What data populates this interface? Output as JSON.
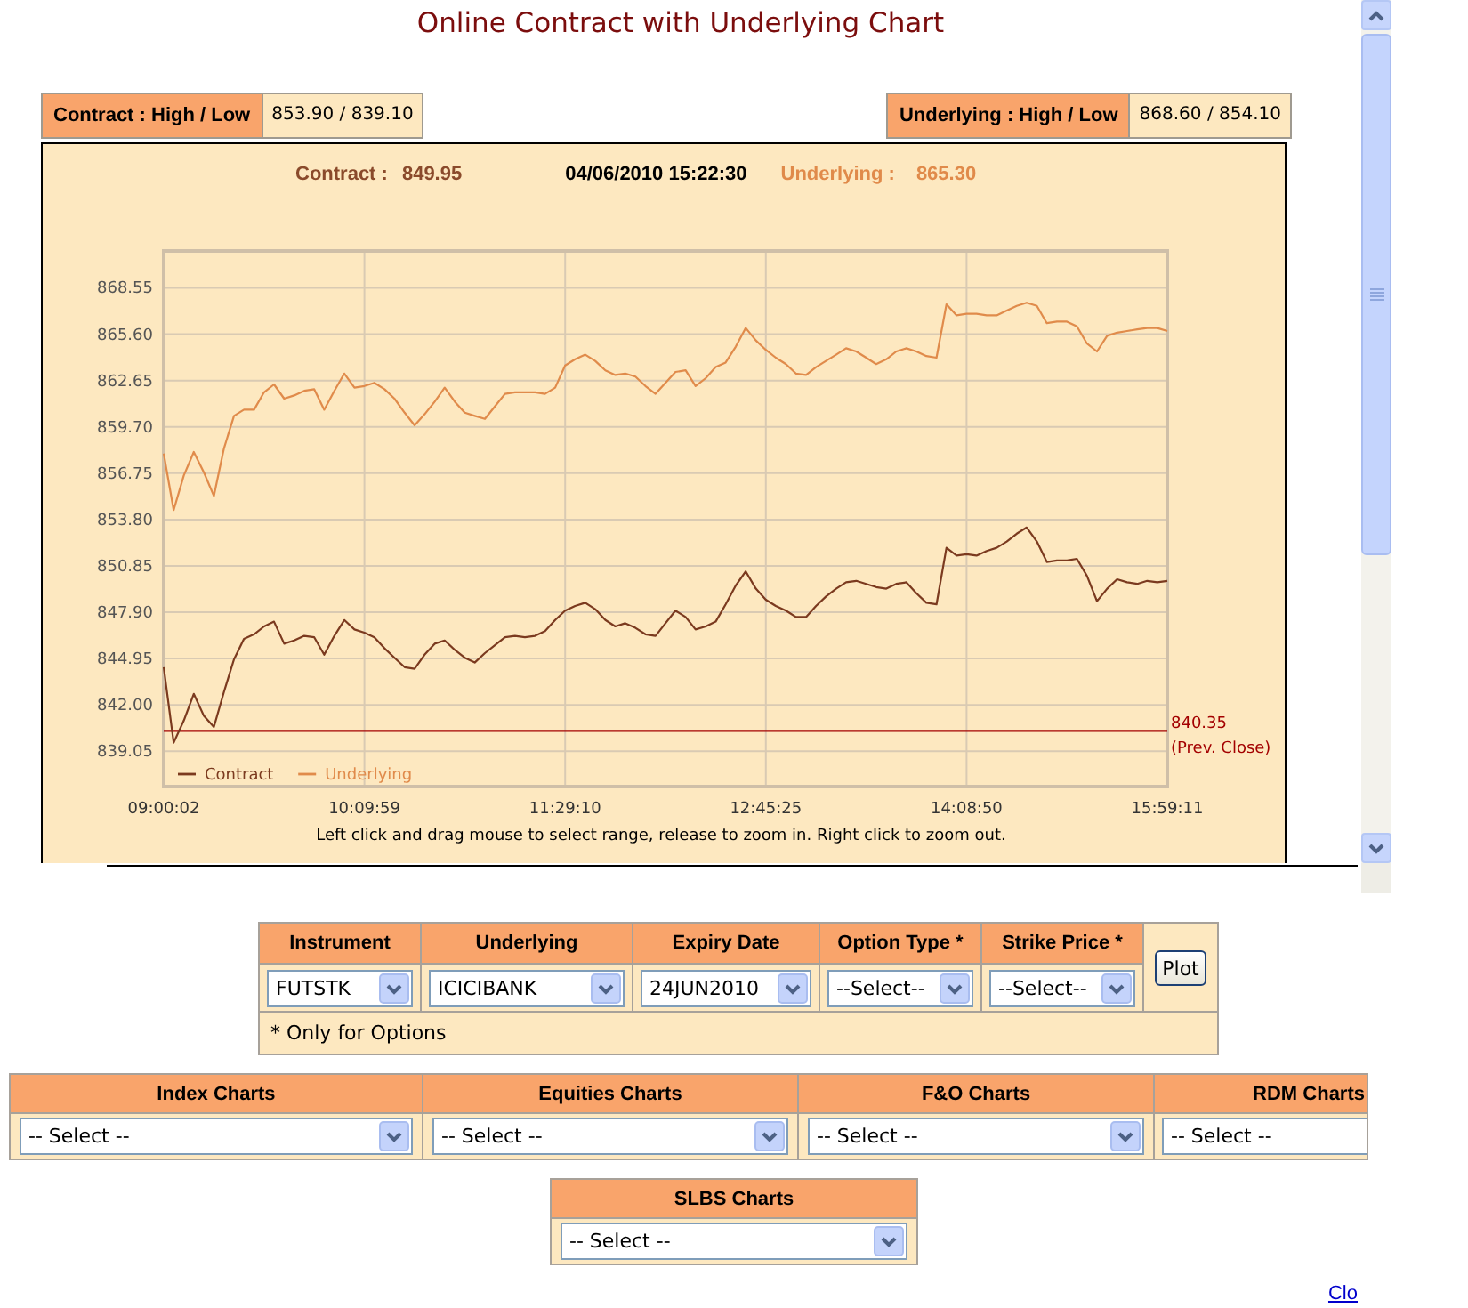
{
  "page_title": "Online Contract with Underlying Chart",
  "high_low": [
    {
      "label": "Contract : High / Low",
      "value": "853.90 / 839.10"
    },
    {
      "label": "Underlying : High / Low",
      "value": "868.60 / 854.10"
    }
  ],
  "chart_panel": {
    "contract_label": "Contract :",
    "contract_value": "849.95",
    "timestamp": "04/06/2010 15:22:30",
    "underlying_label": "Underlying :",
    "underlying_value": "865.30",
    "chart_data": {
      "type": "line",
      "categories": [
        "09:00:02",
        null,
        null,
        null,
        null,
        null,
        null,
        null,
        null,
        null,
        null,
        null,
        null,
        null,
        null,
        null,
        null,
        null,
        null,
        null,
        "10:09:59",
        null,
        null,
        null,
        null,
        null,
        null,
        null,
        null,
        null,
        null,
        null,
        null,
        null,
        null,
        null,
        null,
        null,
        null,
        null,
        "11:29:10",
        null,
        null,
        null,
        null,
        null,
        null,
        null,
        null,
        null,
        null,
        null,
        null,
        null,
        null,
        null,
        null,
        null,
        null,
        null,
        "12:45:25",
        null,
        null,
        null,
        null,
        null,
        null,
        null,
        null,
        null,
        null,
        null,
        null,
        null,
        null,
        null,
        null,
        null,
        null,
        null,
        "14:08:50",
        null,
        null,
        null,
        null,
        null,
        null,
        null,
        null,
        null,
        null,
        null,
        null,
        null,
        null,
        null,
        null,
        null,
        null,
        null,
        "15:59:11"
      ],
      "series": [
        {
          "name": "Contract",
          "color": "#7b3a1f",
          "values": [
            844.4,
            839.6,
            841.0,
            842.7,
            841.3,
            840.6,
            842.8,
            844.9,
            846.2,
            846.5,
            847.0,
            847.3,
            845.9,
            846.1,
            846.4,
            846.3,
            845.2,
            846.4,
            847.4,
            846.8,
            846.6,
            846.3,
            845.6,
            845.0,
            844.4,
            844.3,
            845.2,
            845.9,
            846.1,
            845.5,
            845.0,
            844.7,
            845.3,
            845.8,
            846.3,
            846.4,
            846.3,
            846.4,
            846.7,
            847.4,
            848.0,
            848.3,
            848.5,
            848.1,
            847.4,
            847.0,
            847.2,
            846.9,
            846.5,
            846.4,
            847.2,
            848.0,
            847.6,
            846.8,
            847.0,
            847.3,
            848.4,
            849.6,
            850.5,
            849.4,
            848.7,
            848.3,
            848.0,
            847.6,
            847.6,
            848.3,
            848.9,
            849.4,
            849.8,
            849.9,
            849.7,
            849.5,
            849.4,
            849.7,
            849.8,
            849.1,
            848.5,
            848.4,
            852.0,
            851.5,
            851.6,
            851.5,
            851.8,
            852.0,
            852.4,
            852.9,
            853.3,
            852.4,
            851.1,
            851.2,
            851.2,
            851.3,
            850.2,
            848.6,
            849.4,
            850.0,
            849.8,
            849.7,
            849.9,
            849.8,
            849.9
          ]
        },
        {
          "name": "Underlying",
          "color": "#e08b4b",
          "values": [
            858.0,
            854.4,
            856.6,
            858.1,
            856.8,
            855.3,
            858.3,
            860.4,
            860.8,
            860.8,
            861.9,
            862.4,
            861.5,
            861.7,
            862.0,
            862.1,
            860.8,
            862.0,
            863.1,
            862.2,
            862.3,
            862.5,
            862.1,
            861.5,
            860.6,
            859.8,
            860.5,
            861.3,
            862.2,
            861.3,
            860.6,
            860.4,
            860.2,
            861.0,
            861.8,
            861.9,
            861.9,
            861.9,
            861.8,
            862.2,
            863.6,
            864.0,
            864.3,
            863.9,
            863.3,
            863.0,
            863.1,
            862.9,
            862.3,
            861.8,
            862.5,
            863.2,
            863.3,
            862.3,
            862.8,
            863.5,
            863.8,
            864.8,
            866.0,
            865.2,
            864.6,
            864.1,
            863.7,
            863.1,
            863.0,
            863.5,
            863.9,
            864.3,
            864.7,
            864.5,
            864.1,
            863.7,
            864.0,
            864.5,
            864.7,
            864.5,
            864.2,
            864.1,
            867.5,
            866.8,
            866.9,
            866.9,
            866.8,
            866.8,
            867.1,
            867.4,
            867.6,
            867.4,
            866.3,
            866.4,
            866.4,
            866.1,
            865.0,
            864.5,
            865.5,
            865.7,
            865.8,
            865.9,
            866.0,
            866.0,
            865.8
          ]
        }
      ],
      "ylim": [
        836.8,
        870.9
      ],
      "yticks": [
        {
          "value": 839.05,
          "label": "839.05"
        },
        {
          "value": 842.0,
          "label": "842.00"
        },
        {
          "value": 844.95,
          "label": "844.95"
        },
        {
          "value": 847.9,
          "label": "847.90"
        },
        {
          "value": 850.85,
          "label": "850.85"
        },
        {
          "value": 853.8,
          "label": "853.80"
        },
        {
          "value": 856.75,
          "label": "856.75"
        },
        {
          "value": 859.7,
          "label": "859.70"
        },
        {
          "value": 862.65,
          "label": "862.65"
        },
        {
          "value": 865.6,
          "label": "865.60"
        },
        {
          "value": 868.55,
          "label": "868.55"
        }
      ],
      "grid": true,
      "legend": "lower left",
      "ref_lines": [
        {
          "axis": "y",
          "value": 840.35,
          "label": "840.35 (Prev. Close)"
        }
      ]
    },
    "hint": "Left click and drag mouse to select range, release to zoom in. Right click to zoom out."
  },
  "plot_form": {
    "fields": [
      {
        "label": "Instrument",
        "value": "FUTSTK"
      },
      {
        "label": "Underlying",
        "value": "ICICIBANK"
      },
      {
        "label": "Expiry Date",
        "value": "24JUN2010"
      },
      {
        "label": "Option Type *",
        "value": "--Select--"
      },
      {
        "label": "Strike Price *",
        "value": "--Select--"
      }
    ],
    "button": "Plot",
    "note": "* Only for Options"
  },
  "chart_menus": [
    {
      "label": "Index Charts",
      "value": "-- Select --",
      "cut_off": false
    },
    {
      "label": "Equities Charts",
      "value": "-- Select --",
      "cut_off": false
    },
    {
      "label": "F&O Charts",
      "value": "-- Select --",
      "cut_off": false
    },
    {
      "label": "RDM Charts",
      "value": "-- Select --",
      "cut_off": true
    }
  ],
  "slbs_menu": {
    "label": "SLBS Charts",
    "value": "-- Select --"
  },
  "close_link": "Clo"
}
